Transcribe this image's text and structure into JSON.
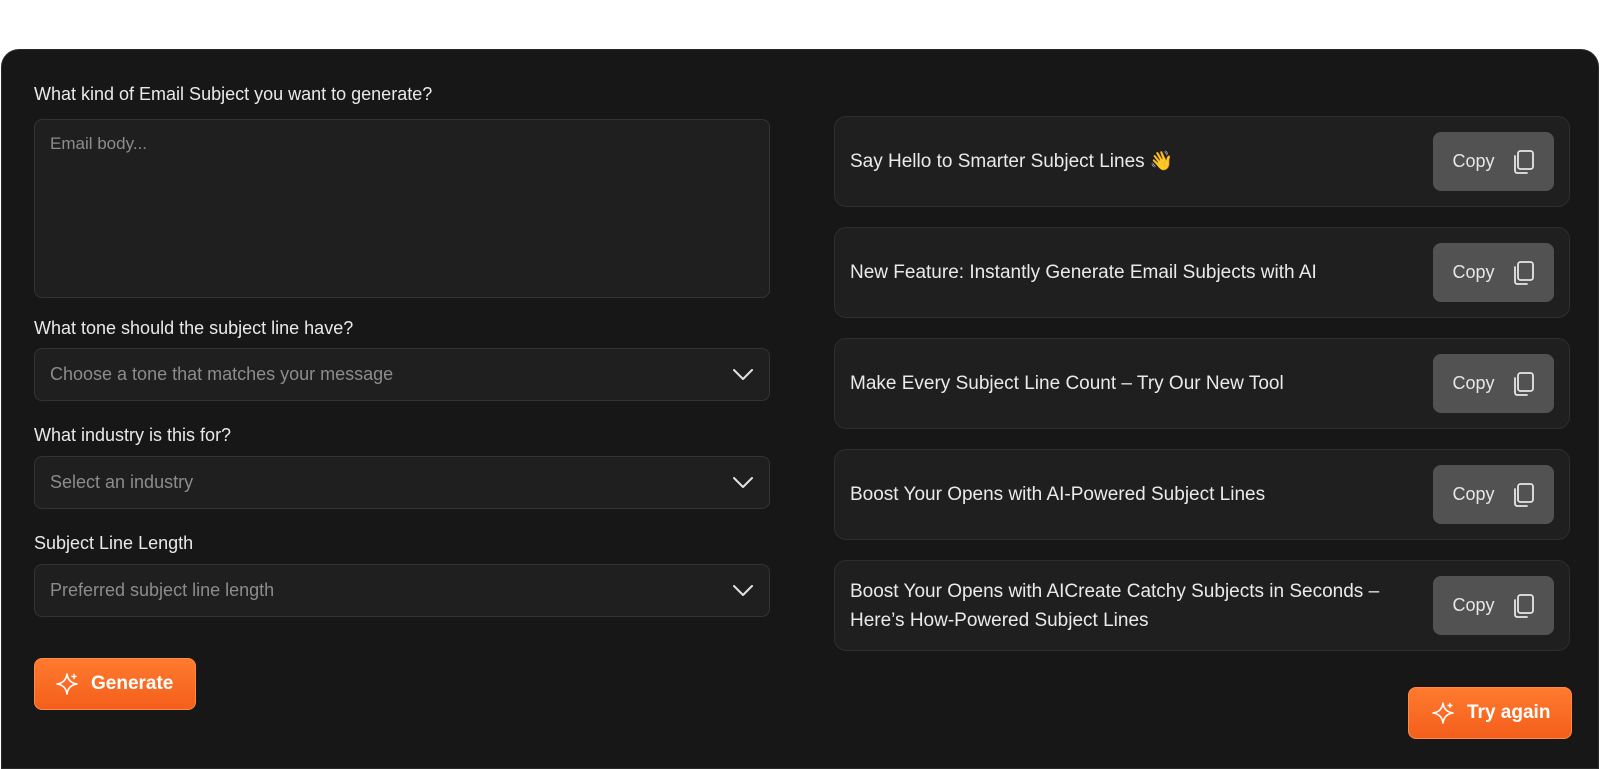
{
  "form": {
    "subject_kind_label": "What kind of Email Subject you want to generate?",
    "email_body_placeholder": "Email body...",
    "tone_label": "What tone should the subject line have?",
    "tone_placeholder": "Choose a tone that matches your message",
    "industry_label": "What industry is this for?",
    "industry_placeholder": "Select an industry",
    "length_label": "Subject Line Length",
    "length_placeholder": "Preferred subject line length",
    "generate_label": "Generate"
  },
  "results": {
    "items": [
      {
        "text": "Say Hello to Smarter Subject Lines 👋",
        "copy_label": "Copy"
      },
      {
        "text": "New Feature: Instantly Generate Email Subjects with AI",
        "copy_label": "Copy"
      },
      {
        "text": "Make Every Subject Line Count – Try Our New Tool",
        "copy_label": "Copy"
      },
      {
        "text": "Boost Your Opens with AI-Powered Subject Lines",
        "copy_label": "Copy"
      },
      {
        "text": "Boost Your Opens with AICreate Catchy Subjects in Seconds – Here’s How-Powered Subject Lines",
        "copy_label": "Copy"
      }
    ],
    "try_again_label": "Try again"
  },
  "colors": {
    "panel_bg": "#171717",
    "field_bg": "#1f1f1f",
    "accent": "#f76a24",
    "copy_bg": "#525252"
  },
  "icons": {
    "chevron": "chevron-down-icon",
    "sparkle": "sparkle-icon",
    "copy": "copy-icon"
  }
}
